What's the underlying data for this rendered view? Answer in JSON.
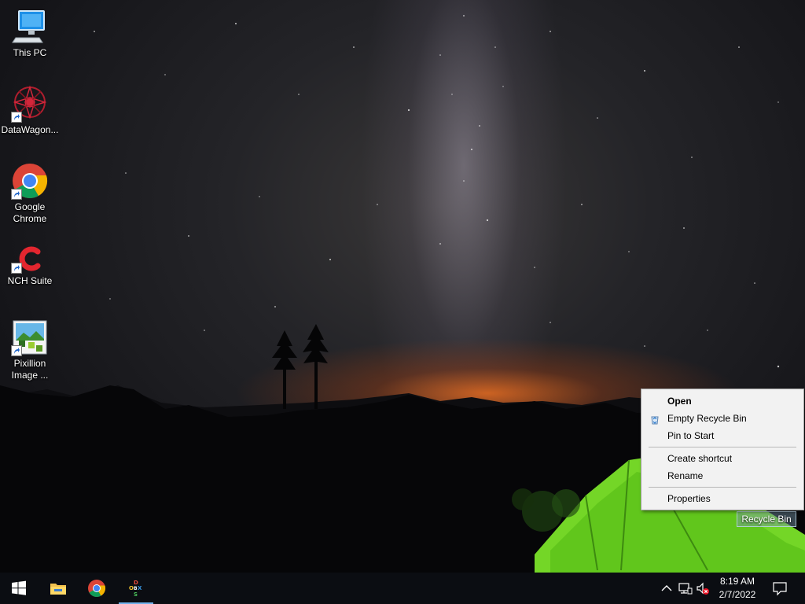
{
  "desktop": {
    "icons": [
      {
        "label": "This PC",
        "icon": "this-pc-icon"
      },
      {
        "label": "DataWagon...",
        "icon": "datawagon-icon"
      },
      {
        "label": "Google Chrome",
        "icon": "chrome-icon"
      },
      {
        "label": "NCH Suite",
        "icon": "nch-suite-icon"
      },
      {
        "label": "Pixillion Image ...",
        "icon": "pixillion-icon"
      }
    ],
    "recycle_bin_label": "Recycle Bin"
  },
  "context_menu": {
    "items": [
      {
        "label": "Open",
        "bold": true
      },
      {
        "label": "Empty Recycle Bin",
        "icon": "empty-recycle-bin-icon"
      },
      {
        "label": "Pin to Start"
      },
      {
        "label": "Create shortcut"
      },
      {
        "label": "Rename"
      },
      {
        "label": "Properties"
      }
    ]
  },
  "taskbar": {
    "pinned": [
      {
        "icon": "windows-start-icon"
      },
      {
        "icon": "file-explorer-icon"
      },
      {
        "icon": "chrome-icon"
      },
      {
        "icon": "dosbox-icon",
        "active": true
      }
    ],
    "tray": {
      "icons": [
        "show-hidden-icons-chevron-icon",
        "network-icon",
        "volume-muted-icon",
        "notifications-icon"
      ],
      "time": "8:19 AM",
      "date": "2/7/2022"
    }
  },
  "colors": {
    "taskbar_bg": "#0b0d12",
    "active_indicator": "#6fb1ea",
    "menu_bg": "#f2f2f2",
    "tent_green": "#7ee82a"
  }
}
